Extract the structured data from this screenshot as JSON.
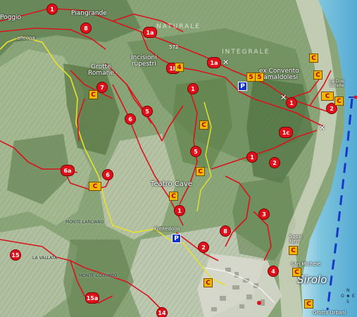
{
  "place_labels": {
    "poggio": "Poggio",
    "piangrande": "Piangrande",
    "grotte_romane": "Grotte\nRomane",
    "incisioni": "Incisioni\nrupestri",
    "ex_convento": "ex Convento\nCamaldolesi",
    "le_due_sorelle": "Le Due\nSorelle",
    "teatro_cave": "Teatro Cave",
    "fontedolio": "Fontedolio",
    "sassi_neri": "Sassi\nNeri",
    "san_michele": "San Michele",
    "sirolo": "Sirolo",
    "grotta_urbani": "Grotta Urbani",
    "monte_larciano": "MONTE LARCIANO",
    "la_vallata": "LA VALLATA",
    "monte_colombo": "MONTE COLOMBO",
    "ancona_road": "ancona",
    "altitude": "572",
    "riserva_1": "NATURALE",
    "riserva_2": "INTEGRALE"
  },
  "trail_markers": [
    "1",
    "8",
    "1a",
    "1b",
    "1a",
    "7",
    "6",
    "6",
    "5",
    "1",
    "1",
    "1c",
    "2",
    "2",
    "1",
    "5",
    "6a",
    "8",
    "1",
    "3",
    "2",
    "4",
    "15",
    "15a",
    "14"
  ],
  "poi_markers": [
    "C",
    "C",
    "C",
    "C",
    "C",
    "C",
    "C",
    "C",
    "C",
    "C",
    "C",
    "C",
    "5",
    "5",
    "4"
  ],
  "parking": [
    "P",
    "P"
  ],
  "compass": {
    "n": "N",
    "s": "S",
    "w": "O",
    "e": "E"
  },
  "colors": {
    "trail": "#d8141c",
    "road": "#e8e030",
    "sea": "#7cc4de",
    "sea_deep": "#5fb0d6",
    "ferry": "#1438c8"
  }
}
